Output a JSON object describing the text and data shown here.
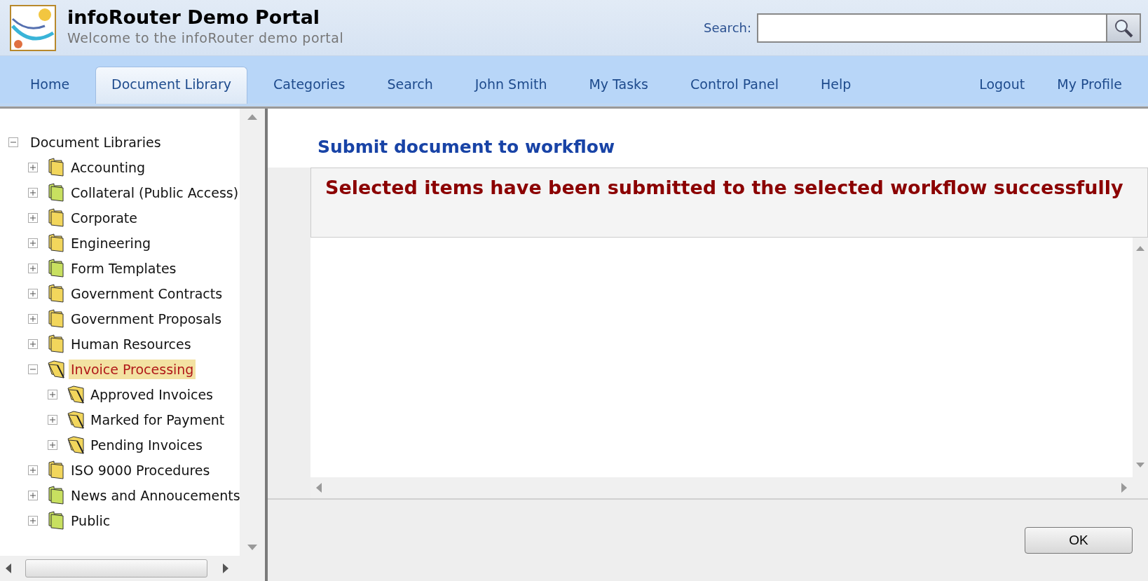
{
  "header": {
    "title": "infoRouter Demo Portal",
    "subtitle": "Welcome to the infoRouter demo portal",
    "search": {
      "label": "Search:"
    }
  },
  "tabs": [
    {
      "label": "Home",
      "selected": false
    },
    {
      "label": "Document Library",
      "selected": true
    },
    {
      "label": "Categories",
      "selected": false
    },
    {
      "label": "Search",
      "selected": false
    },
    {
      "label": "John Smith",
      "selected": false
    },
    {
      "label": "My Tasks",
      "selected": false
    },
    {
      "label": "Control Panel",
      "selected": false
    },
    {
      "label": "Help",
      "selected": false
    }
  ],
  "right_links": [
    "Logout",
    "My Profile"
  ],
  "tree": {
    "label": "Document Libraries",
    "expanded": true,
    "children": [
      {
        "label": "Accounting",
        "color": "#f2d65c",
        "kind": "folder",
        "expanded": false,
        "selected": false
      },
      {
        "label": "Collateral (Public Access)",
        "color": "#c8e060",
        "kind": "folder",
        "expanded": false,
        "selected": false
      },
      {
        "label": "Corporate",
        "color": "#f2d65c",
        "kind": "folder",
        "expanded": false,
        "selected": false
      },
      {
        "label": "Engineering",
        "color": "#f2d65c",
        "kind": "folder",
        "expanded": false,
        "selected": false
      },
      {
        "label": "Form Templates",
        "color": "#c8e060",
        "kind": "folder",
        "expanded": false,
        "selected": false
      },
      {
        "label": "Government Contracts",
        "color": "#f2d65c",
        "kind": "folder",
        "expanded": false,
        "selected": false
      },
      {
        "label": "Government Proposals",
        "color": "#f2d65c",
        "kind": "folder",
        "expanded": false,
        "selected": false
      },
      {
        "label": "Human Resources",
        "color": "#f2d65c",
        "kind": "folder",
        "expanded": false,
        "selected": false
      },
      {
        "label": "Invoice Processing",
        "color": "#f2d65c",
        "kind": "workflow-folder",
        "expanded": true,
        "selected": true,
        "children": [
          {
            "label": "Approved Invoices",
            "color": "#f2d65c",
            "kind": "workflow-folder",
            "expanded": false,
            "selected": false
          },
          {
            "label": "Marked for Payment",
            "color": "#f2d65c",
            "kind": "workflow-folder",
            "expanded": false,
            "selected": false
          },
          {
            "label": "Pending Invoices",
            "color": "#f2d65c",
            "kind": "workflow-folder",
            "expanded": false,
            "selected": false
          }
        ]
      },
      {
        "label": "ISO 9000 Procedures",
        "color": "#f2d65c",
        "kind": "folder",
        "expanded": false,
        "selected": false
      },
      {
        "label": "News and Annoucements",
        "color": "#c8e060",
        "kind": "folder",
        "expanded": false,
        "selected": false
      },
      {
        "label": "Public",
        "color": "#c8e060",
        "kind": "folder",
        "expanded": false,
        "selected": false
      }
    ]
  },
  "content": {
    "title": "Submit document to workflow",
    "message": "Selected items have been submitted to the selected workflow successfully"
  },
  "buttons": [
    "OK"
  ]
}
